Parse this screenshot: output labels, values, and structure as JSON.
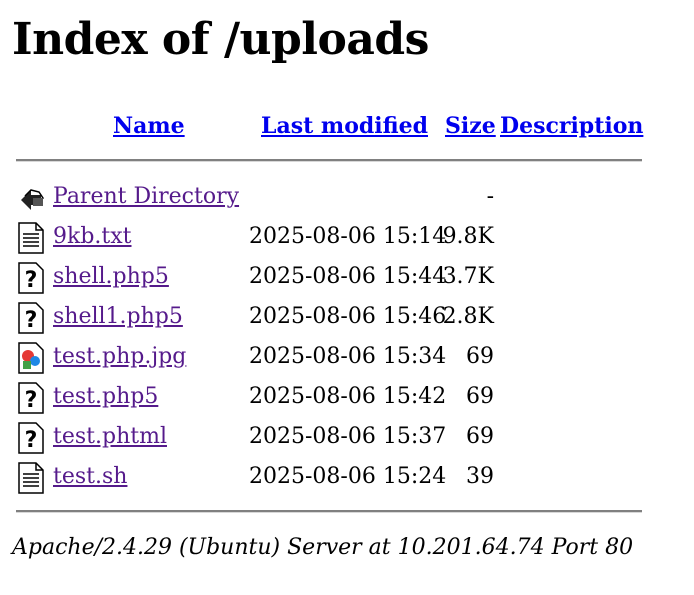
{
  "page": {
    "title": "Index of /uploads"
  },
  "table": {
    "headers": {
      "name": "Name",
      "last_modified": "Last modified",
      "size": "Size",
      "description": "Description"
    },
    "rows": [
      {
        "icon": "back-icon",
        "name": "Parent Directory",
        "date": "",
        "size": "-"
      },
      {
        "icon": "text-file-icon",
        "name": "9kb.txt",
        "date": "2025-08-06 15:14",
        "size": "9.8K"
      },
      {
        "icon": "unknown-file-icon",
        "name": "shell.php5",
        "date": "2025-08-06 15:44",
        "size": "3.7K"
      },
      {
        "icon": "unknown-file-icon",
        "name": "shell1.php5",
        "date": "2025-08-06 15:46",
        "size": "2.8K"
      },
      {
        "icon": "image-file-icon",
        "name": "test.php.jpg",
        "date": "2025-08-06 15:34",
        "size": "69"
      },
      {
        "icon": "unknown-file-icon",
        "name": "test.php5",
        "date": "2025-08-06 15:42",
        "size": "69"
      },
      {
        "icon": "unknown-file-icon",
        "name": "test.phtml",
        "date": "2025-08-06 15:37",
        "size": "69"
      },
      {
        "icon": "text-file-icon",
        "name": "test.sh",
        "date": "2025-08-06 15:24",
        "size": "39"
      }
    ]
  },
  "footer": {
    "server_signature": "Apache/2.4.29 (Ubuntu) Server at 10.201.64.74 Port 80"
  }
}
